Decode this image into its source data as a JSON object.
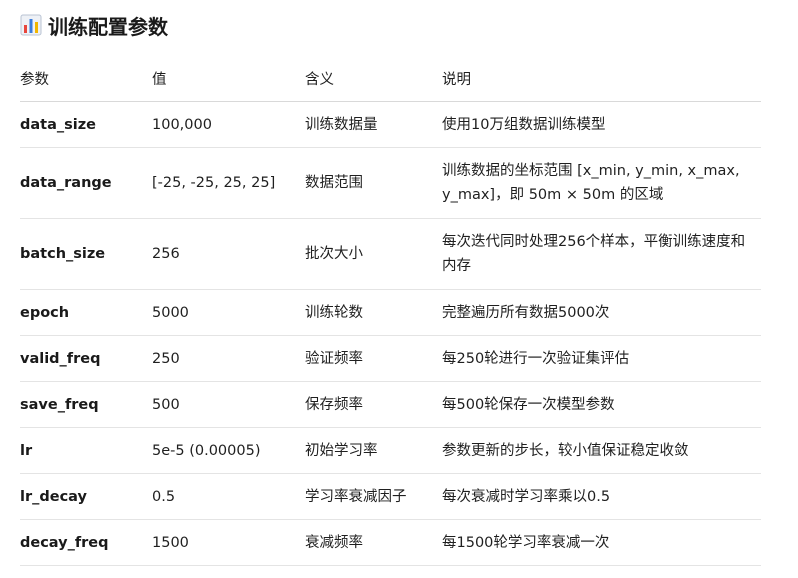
{
  "header": {
    "title": "训练配置参数",
    "icon": "bar-chart-icon"
  },
  "table": {
    "columns": [
      "参数",
      "值",
      "含义",
      "说明"
    ],
    "rows": [
      {
        "param": "data_size",
        "value": "100,000",
        "meaning": "训练数据量",
        "desc": "使用10万组数据训练模型"
      },
      {
        "param": "data_range",
        "value": "[-25, -25, 25, 25]",
        "meaning": "数据范围",
        "desc": "训练数据的坐标范围 [x_min, y_min, x_max, y_max]，即 50m × 50m 的区域"
      },
      {
        "param": "batch_size",
        "value": "256",
        "meaning": "批次大小",
        "desc": "每次迭代同时处理256个样本，平衡训练速度和内存"
      },
      {
        "param": "epoch",
        "value": "5000",
        "meaning": "训练轮数",
        "desc": "完整遍历所有数据5000次"
      },
      {
        "param": "valid_freq",
        "value": "250",
        "meaning": "验证频率",
        "desc": "每250轮进行一次验证集评估"
      },
      {
        "param": "save_freq",
        "value": "500",
        "meaning": "保存频率",
        "desc": "每500轮保存一次模型参数"
      },
      {
        "param": "lr",
        "value": "5e-5 (0.00005)",
        "meaning": "初始学习率",
        "desc": "参数更新的步长，较小值保证稳定收敛"
      },
      {
        "param": "lr_decay",
        "value": "0.5",
        "meaning": "学习率衰减因子",
        "desc": "每次衰减时学习率乘以0.5"
      },
      {
        "param": "decay_freq",
        "value": "1500",
        "meaning": "衰减频率",
        "desc": "每1500轮学习率衰减一次"
      }
    ]
  }
}
